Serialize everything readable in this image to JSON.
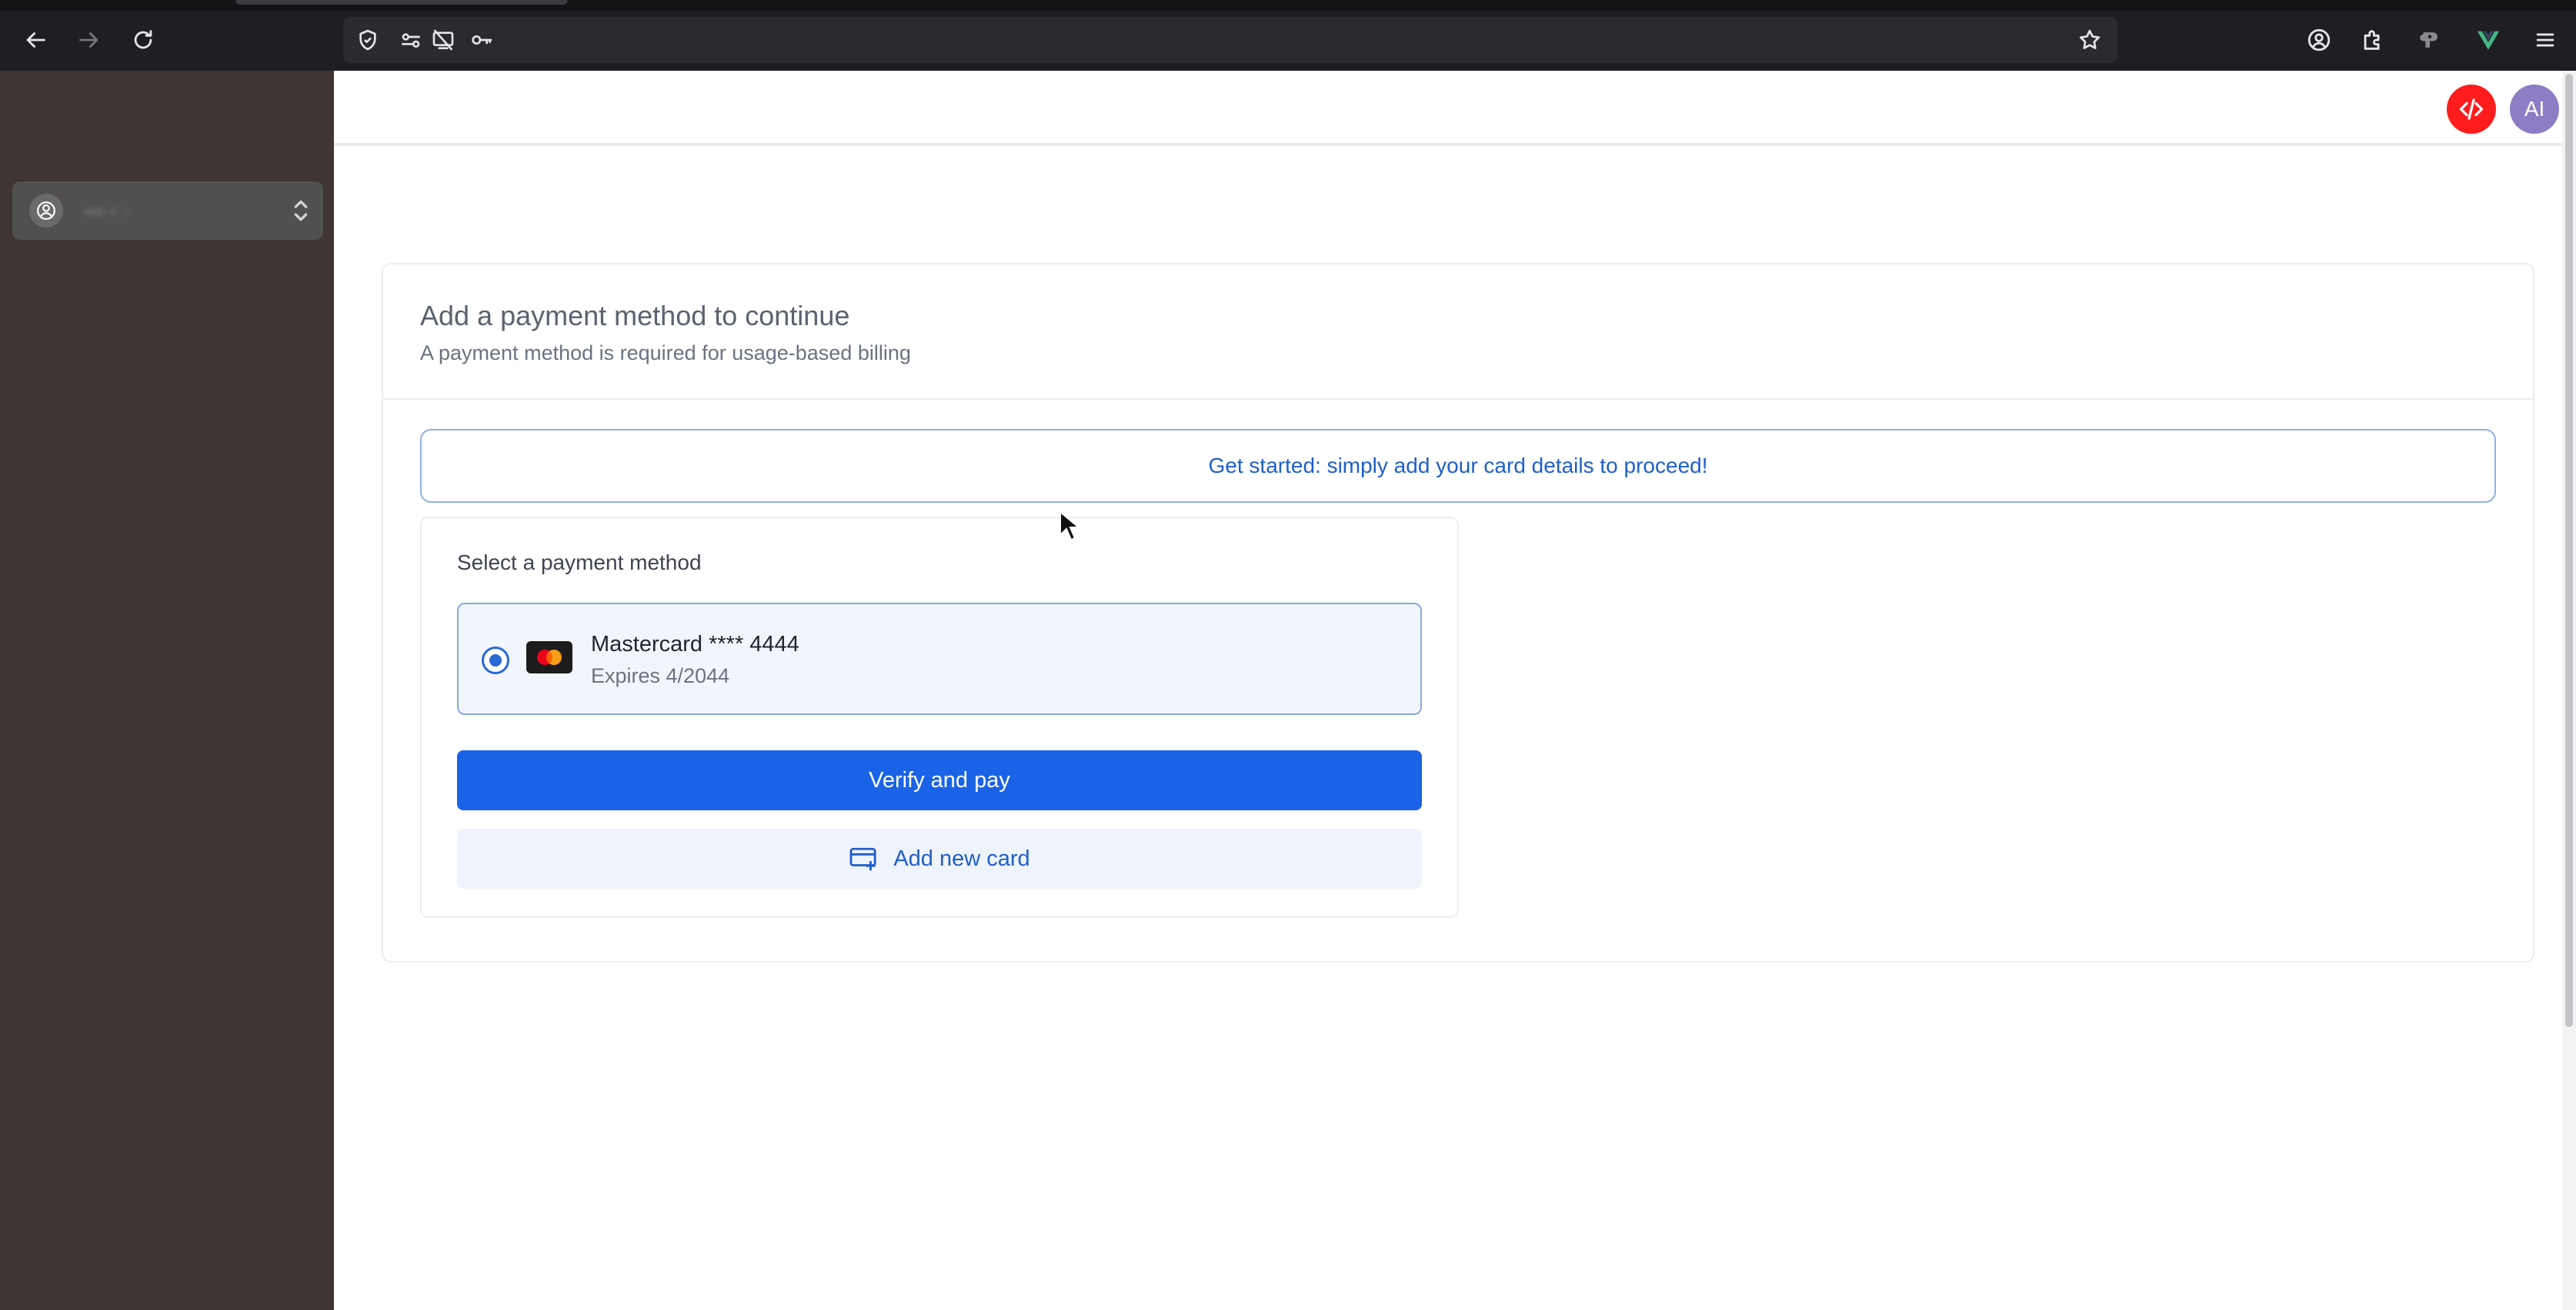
{
  "browser": {
    "url_text": "",
    "icons": [
      "back-icon",
      "forward-icon",
      "reload-icon",
      "shield-icon",
      "permissions-icon",
      "screen-share-blocked-icon",
      "key-icon",
      "bookmark-star-icon",
      "account-icon",
      "extensions-icon",
      "extension-icon",
      "vue-devtools-icon",
      "menu-icon"
    ]
  },
  "sidebar": {
    "workspace_name": "— - ·"
  },
  "header": {
    "avatar_initials": "AI",
    "devtools_icon": "code-icon",
    "devtools_color": "#ff1c1c"
  },
  "card": {
    "title": "Add a payment method to continue",
    "subtitle": "A payment method is required for usage-based billing",
    "banner": "Get started: simply add your card details to proceed!",
    "select_label": "Select a payment method",
    "method": {
      "name": "Mastercard **** 4444",
      "expiry": "Expires 4/2044",
      "selected": true,
      "logo_icon": "mastercard-icon"
    },
    "verify_label": "Verify and pay",
    "add_card_label": "Add new card",
    "add_card_icon": "add-card-icon"
  },
  "colors": {
    "accent": "#1b63e6",
    "link": "#1f5fc9",
    "sidebar_bg": "#3e3534",
    "chrome_bg": "#1f1e22"
  }
}
